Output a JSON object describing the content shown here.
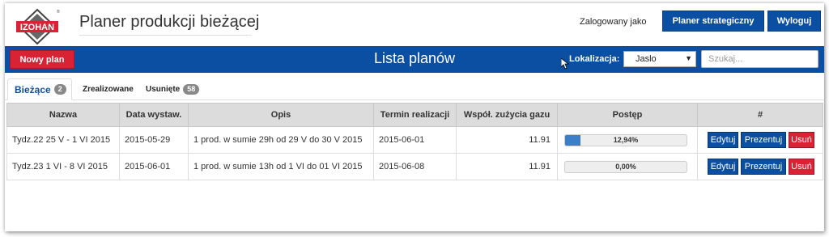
{
  "header": {
    "logo_text": "IZOHAN",
    "app_title": "Planer produkcji bieżącej",
    "logged_as": "Zalogowany jako",
    "strategic_button": "Planer strategiczny",
    "logout_button": "Wyloguj"
  },
  "toolbar": {
    "new_plan_button": "Nowy plan",
    "title": "Lista planów",
    "location_label": "Lokalizacja:",
    "location_value": "Jaslo",
    "search_placeholder": "Szukaj..."
  },
  "tabs": [
    {
      "label": "Bieżące",
      "count": "2",
      "active": true
    },
    {
      "label": "Zrealizowane",
      "count": "",
      "active": false
    },
    {
      "label": "Usunięte",
      "count": "58",
      "active": false
    }
  ],
  "table": {
    "columns": [
      "Nazwa",
      "Data wystaw.",
      "Opis",
      "Termin realizacji",
      "Współ. zużycia gazu",
      "Postęp",
      "#"
    ],
    "rows": [
      {
        "name": "Tydz.22 25 V - 1 VI 2015",
        "date": "2015-05-29",
        "desc": "1 prod. w sumie 29h od 29 V do 30 V 2015",
        "deadline": "2015-06-01",
        "gas": "11.91",
        "progress_label": "12,94%",
        "progress": 0.1294
      },
      {
        "name": "Tydz.23 1 VI - 8 VI 2015",
        "date": "2015-06-01",
        "desc": "1 prod. w sumie 13h od 1 VI do 01 VI 2015",
        "deadline": "2015-06-08",
        "gas": "11.91",
        "progress_label": "0,00%",
        "progress": 0
      }
    ],
    "actions": {
      "edit": "Edytuj",
      "present": "Prezentuj",
      "delete": "Usuń"
    }
  },
  "colors": {
    "primary": "#0b4fa3",
    "danger": "#d92335",
    "header_bg": "#dcdcdc"
  }
}
